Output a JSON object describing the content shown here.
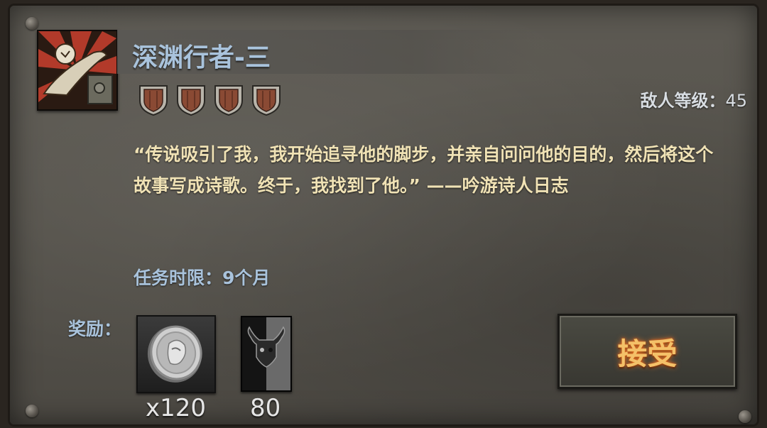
{
  "quest": {
    "title": "深渊行者-三",
    "difficulty_shields": 4,
    "enemy_level_label": "敌人等级：",
    "enemy_level_value": "45",
    "description": "“传说吸引了我，我开始追寻他的脚步，并亲自问问他的目的，然后将这个故事写成诗歌。终于，我找到了他。” ——吟游诗人日志",
    "time_limit": "任务时限：9个月"
  },
  "rewards": {
    "label": "奖励：",
    "items": [
      {
        "icon": "silver-coin-icon",
        "count": "x120"
      },
      {
        "icon": "horned-banner-icon",
        "count": "80"
      }
    ]
  },
  "actions": {
    "accept_label": "接受"
  },
  "colors": {
    "title_blue": "#a9c3dc",
    "description_cream": "#f0e2b5",
    "accept_glow": "#f4c169"
  }
}
